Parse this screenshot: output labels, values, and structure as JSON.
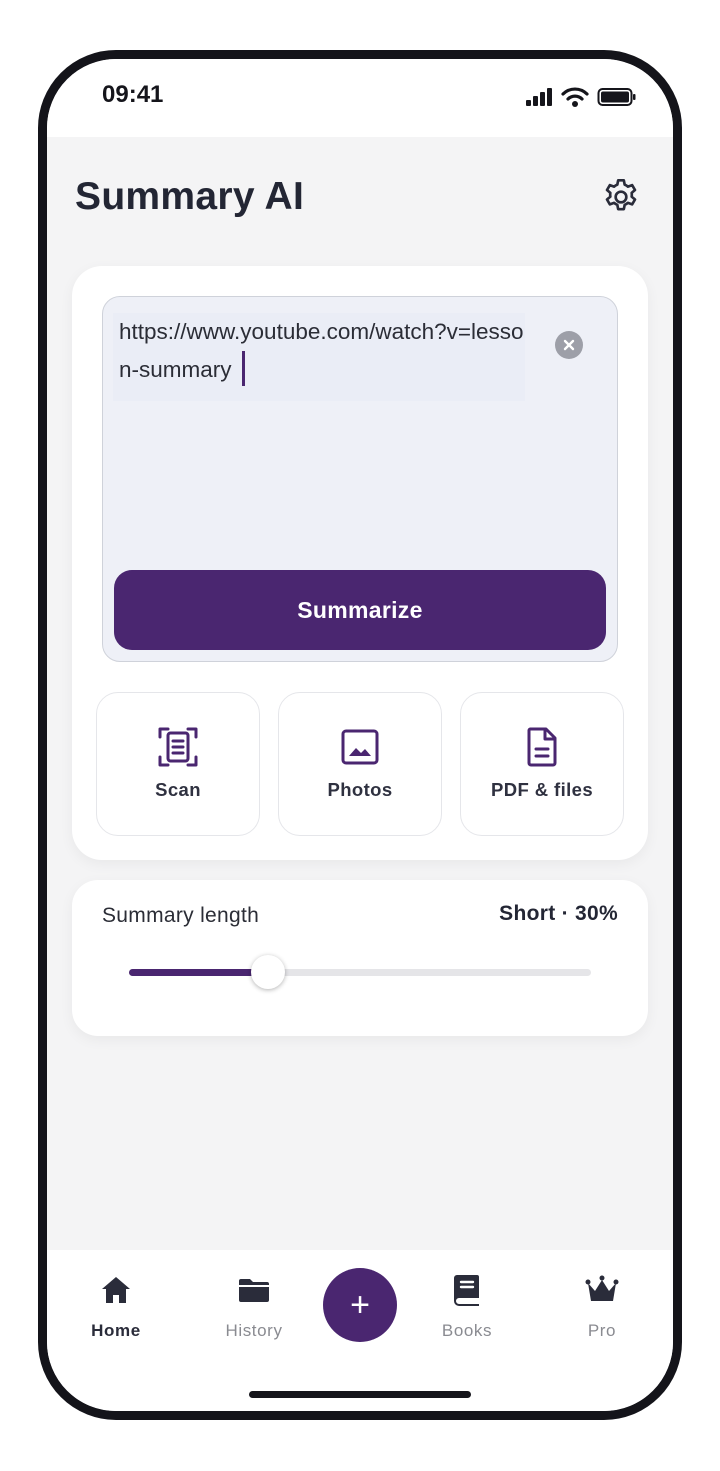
{
  "status": {
    "time": "09:41"
  },
  "header": {
    "title": "Summary AI",
    "settings_icon": "gear-icon"
  },
  "input": {
    "value": "https://www.youtube.com/watch?v=lesson-summary",
    "clear_icon": "clear-icon"
  },
  "summarize": {
    "label": "Summarize"
  },
  "sources": [
    {
      "label": "Scan",
      "icon": "scan-icon"
    },
    {
      "label": "Photos",
      "icon": "photo-icon"
    },
    {
      "label": "PDF & files",
      "icon": "file-icon"
    }
  ],
  "length": {
    "label": "Summary length",
    "value_text": "Short · 30%",
    "slider_fraction": 0.3
  },
  "tabs": [
    {
      "label": "Home",
      "icon": "home-icon",
      "active": true
    },
    {
      "label": "History",
      "icon": "folder-icon",
      "active": false
    },
    {
      "label": "Books",
      "icon": "book-icon",
      "active": false
    },
    {
      "label": "Pro",
      "icon": "crown-icon",
      "active": false
    }
  ],
  "fab": {
    "label": "+"
  },
  "colors": {
    "accent": "#4a2670",
    "background": "#f4f4f5",
    "text": "#232634",
    "muted": "#8a8b91"
  }
}
